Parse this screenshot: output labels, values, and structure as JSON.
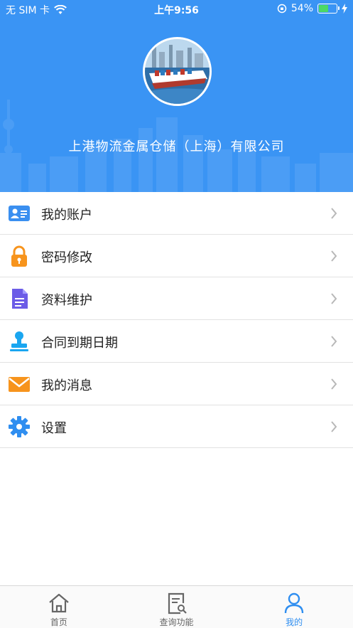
{
  "status_bar": {
    "carrier": "无 SIM 卡",
    "time": "上午9:56",
    "battery_percent": "54%",
    "battery_level": 0.54
  },
  "profile": {
    "company_name": "上港物流金属仓储（上海）有限公司"
  },
  "menu": {
    "items": [
      {
        "label": "我的账户",
        "icon": "account-card-icon",
        "color": "#3a8ff0"
      },
      {
        "label": "密码修改",
        "icon": "lock-icon",
        "color": "#f7941d"
      },
      {
        "label": "资料维护",
        "icon": "document-icon",
        "color": "#6c5ce7"
      },
      {
        "label": "合同到期日期",
        "icon": "stamp-icon",
        "color": "#1aa6f0"
      },
      {
        "label": "我的消息",
        "icon": "envelope-icon",
        "color": "#f7941d"
      },
      {
        "label": "设置",
        "icon": "gear-icon",
        "color": "#2f8ef0"
      }
    ]
  },
  "tabbar": {
    "tabs": [
      {
        "label": "首页",
        "icon": "home-icon",
        "active": false
      },
      {
        "label": "查询功能",
        "icon": "search-document-icon",
        "active": false
      },
      {
        "label": "我的",
        "icon": "person-icon",
        "active": true
      }
    ]
  },
  "colors": {
    "header_bg": "#3a94f4",
    "active_tab": "#2f8ef0",
    "inactive_tab": "#666666"
  }
}
